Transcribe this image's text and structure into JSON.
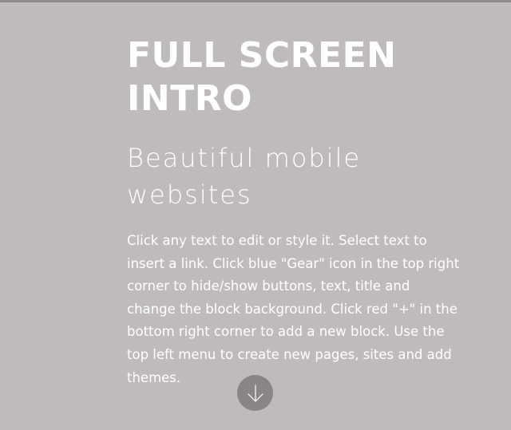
{
  "hero": {
    "title": "FULL SCREEN INTRO",
    "subtitle": "Beautiful mobile websites",
    "description": "Click any text to edit or style it. Select text to insert a link. Click blue \"Gear\" icon in the top right corner to hide/show buttons, text, title and change the block background. Click red \"+\" in the bottom right corner to add a new block. Use the top left menu to create new pages, sites and add themes."
  },
  "scroll_button": {
    "icon": "arrow-down-icon"
  },
  "colors": {
    "background": "#c0bbbb",
    "text": "#ffffff",
    "button": "#8a8585"
  }
}
